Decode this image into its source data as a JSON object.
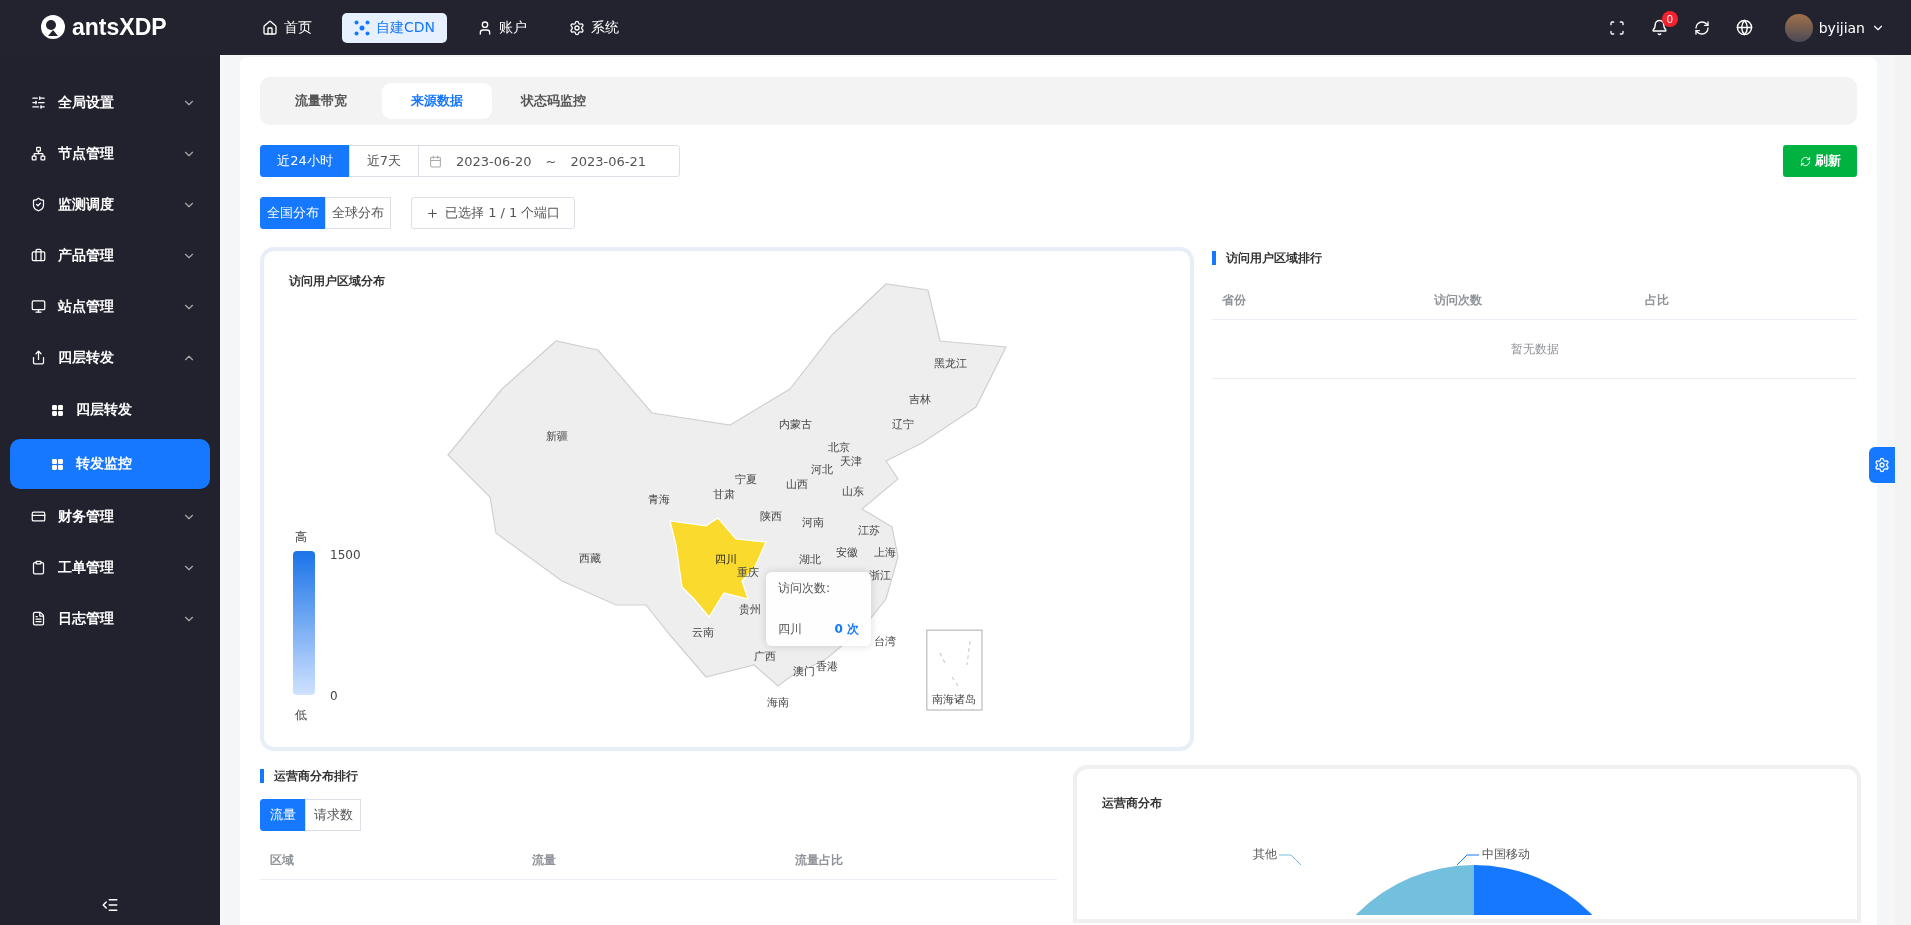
{
  "header": {
    "logo": "antsXDP",
    "nav": [
      {
        "label": "首页",
        "selected": false
      },
      {
        "label": "自建CDN",
        "selected": true
      },
      {
        "label": "账户",
        "selected": false
      },
      {
        "label": "系统",
        "selected": false
      }
    ],
    "notification_count": "0",
    "user": "byijian"
  },
  "sidebar": {
    "items": [
      {
        "label": "全局设置",
        "expanded": false
      },
      {
        "label": "节点管理",
        "expanded": false
      },
      {
        "label": "监测调度",
        "expanded": false
      },
      {
        "label": "产品管理",
        "expanded": false
      },
      {
        "label": "站点管理",
        "expanded": false
      },
      {
        "label": "四层转发",
        "expanded": true,
        "children": [
          {
            "label": "四层转发",
            "selected": false
          },
          {
            "label": "转发监控",
            "selected": true
          }
        ]
      },
      {
        "label": "财务管理",
        "expanded": false
      },
      {
        "label": "工单管理",
        "expanded": false
      },
      {
        "label": "日志管理",
        "expanded": false
      }
    ]
  },
  "tabs": [
    {
      "label": "流量带宽",
      "selected": false
    },
    {
      "label": "来源数据",
      "selected": true
    },
    {
      "label": "状态码监控",
      "selected": false
    }
  ],
  "time_range": {
    "options": [
      {
        "label": "近24小时",
        "selected": true
      },
      {
        "label": "近7天",
        "selected": false
      }
    ],
    "start": "2023-06-20",
    "separator": "~",
    "end": "2023-06-21"
  },
  "refresh_button": "刷新",
  "scope": {
    "options": [
      {
        "label": "全国分布",
        "selected": true
      },
      {
        "label": "全球分布",
        "selected": false
      }
    ],
    "port_button": "已选择 1 / 1 个端口"
  },
  "map_card": {
    "title": "访问用户区域分布",
    "legend": {
      "high": "高",
      "max": "1500",
      "min": "0",
      "low": "低"
    },
    "regions": [
      {
        "name": "新疆",
        "selected": false
      },
      {
        "name": "西藏",
        "selected": false
      },
      {
        "name": "青海",
        "selected": false
      },
      {
        "name": "甘肃",
        "selected": false
      },
      {
        "name": "宁夏",
        "selected": false
      },
      {
        "name": "内蒙古",
        "selected": false
      },
      {
        "name": "黑龙江",
        "selected": false
      },
      {
        "name": "吉林",
        "selected": false
      },
      {
        "name": "辽宁",
        "selected": false
      },
      {
        "name": "北京",
        "selected": false
      },
      {
        "name": "天津",
        "selected": false
      },
      {
        "name": "河北",
        "selected": false
      },
      {
        "name": "山西",
        "selected": false
      },
      {
        "name": "山东",
        "selected": false
      },
      {
        "name": "陕西",
        "selected": false
      },
      {
        "name": "河南",
        "selected": false
      },
      {
        "name": "江苏",
        "selected": false
      },
      {
        "name": "四川",
        "selected": true
      },
      {
        "name": "重庆",
        "selected": false
      },
      {
        "name": "湖北",
        "selected": false
      },
      {
        "name": "安徽",
        "selected": false
      },
      {
        "name": "上海",
        "selected": false
      },
      {
        "name": "浙江",
        "selected": false
      },
      {
        "name": "贵州",
        "selected": false
      },
      {
        "name": "云南",
        "selected": false
      },
      {
        "name": "广西",
        "selected": false
      },
      {
        "name": "台湾",
        "selected": false
      },
      {
        "name": "澳门",
        "selected": false
      },
      {
        "name": "香港",
        "selected": false
      },
      {
        "name": "海南",
        "selected": false
      },
      {
        "name": "南海诸岛",
        "selected": false
      }
    ],
    "tooltip": {
      "title": "访问次数:",
      "region": "四川",
      "value": "0 次"
    }
  },
  "ranking": {
    "title": "访问用户区域排行",
    "columns": [
      "省份",
      "访问次数",
      "占比"
    ],
    "empty": "暂无数据"
  },
  "isp_ranking": {
    "title": "运营商分布排行",
    "options": [
      {
        "label": "流量",
        "selected": true
      },
      {
        "label": "请求数",
        "selected": false
      }
    ],
    "columns": [
      "区域",
      "流量",
      "流量占比"
    ]
  },
  "isp_chart": {
    "title": "运营商分布",
    "labels": [
      "其他",
      "中国移动"
    ]
  }
}
